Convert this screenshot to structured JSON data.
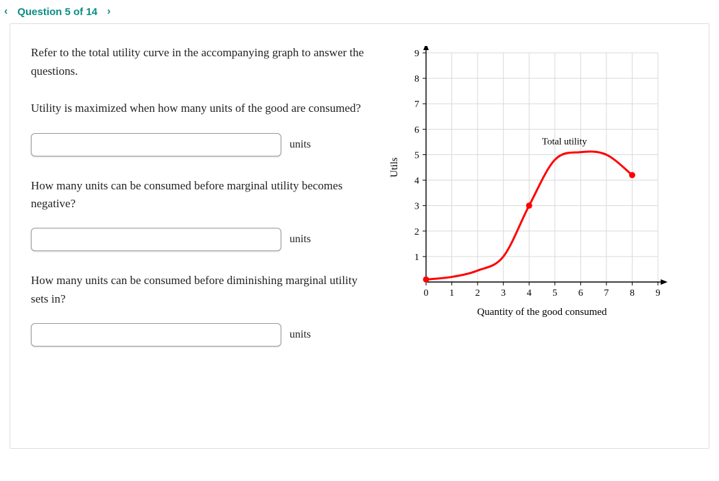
{
  "nav": {
    "prev_icon": "‹",
    "next_icon": "›",
    "title": "Question 5 of 14"
  },
  "intro": "Refer to the total utility curve in the accompanying graph to answer the questions.",
  "q1": "Utility is maximized when how many units of the good are consumed?",
  "q2": "How many units can be consumed before marginal utility becomes negative?",
  "q3": "How many units can be consumed before diminishing marginal utility sets in?",
  "units_label": "units",
  "a1": "",
  "a2": "",
  "a3": "",
  "chart_data": {
    "type": "line",
    "title": "",
    "xlabel": "Quantity of the good consumed",
    "ylabel": "Utils",
    "annotation": "Total utility",
    "xlim": [
      0,
      9
    ],
    "ylim": [
      0,
      9
    ],
    "xticks": [
      0,
      1,
      2,
      3,
      4,
      5,
      6,
      7,
      8,
      9
    ],
    "yticks": [
      1,
      2,
      3,
      4,
      5,
      6,
      7,
      8,
      9
    ],
    "series": [
      {
        "name": "Total utility",
        "color": "#ff0000",
        "points": [
          {
            "x": 0,
            "y": 0.1
          },
          {
            "x": 1,
            "y": 0.2
          },
          {
            "x": 2,
            "y": 0.45
          },
          {
            "x": 3,
            "y": 1.0
          },
          {
            "x": 4,
            "y": 3.0
          },
          {
            "x": 5,
            "y": 4.8
          },
          {
            "x": 6,
            "y": 5.1
          },
          {
            "x": 7,
            "y": 5.0
          },
          {
            "x": 8,
            "y": 4.2
          }
        ],
        "markers_at": [
          0,
          4,
          8
        ]
      }
    ]
  }
}
